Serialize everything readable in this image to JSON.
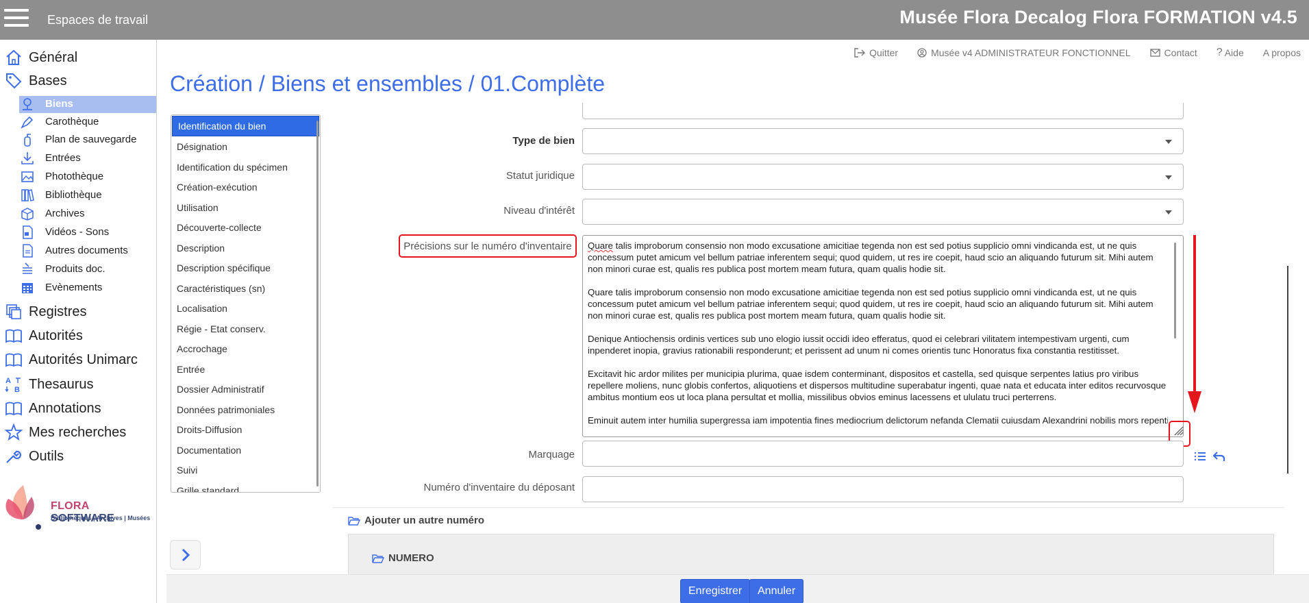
{
  "topbar": {
    "workspaces_label": "Espaces de travail",
    "app_title": "Musée Flora Decalog Flora FORMATION v4.5"
  },
  "sidebar": {
    "main_items": [
      {
        "label": "Général",
        "icon": "home-icon"
      },
      {
        "label": "Bases",
        "icon": "tag-icon"
      },
      {
        "label": "Registres",
        "icon": "registers-icon"
      },
      {
        "label": "Autorités",
        "icon": "book-icon"
      },
      {
        "label": "Autorités Unimarc",
        "icon": "book-icon"
      },
      {
        "label": "Thesaurus",
        "icon": "thesaurus-icon"
      },
      {
        "label": "Annotations",
        "icon": "book-icon"
      },
      {
        "label": "Mes recherches",
        "icon": "star-icon"
      },
      {
        "label": "Outils",
        "icon": "wrench-icon"
      }
    ],
    "sub_items": [
      {
        "label": "Biens",
        "icon": "object-icon",
        "active": true
      },
      {
        "label": "Carothèque",
        "icon": "pen-icon"
      },
      {
        "label": "Plan de sauvegarde",
        "icon": "extinguisher-icon"
      },
      {
        "label": "Entrées",
        "icon": "download-icon"
      },
      {
        "label": "Photothèque",
        "icon": "image-icon"
      },
      {
        "label": "Bibliothèque",
        "icon": "books-icon"
      },
      {
        "label": "Archives",
        "icon": "archive-box-icon"
      },
      {
        "label": "Vidéos - Sons",
        "icon": "video-icon"
      },
      {
        "label": "Autres documents",
        "icon": "document-icon"
      },
      {
        "label": "Produits doc.",
        "icon": "stack-icon"
      },
      {
        "label": "Evènements",
        "icon": "calendar-icon"
      }
    ],
    "logo": {
      "brand": "FLORA",
      "brand2": "SOFTWARE",
      "tagline": "Bibliothèques | Archives | Musées"
    }
  },
  "header_links": [
    {
      "label": "Quitter",
      "icon": "logout-icon"
    },
    {
      "label": "Musée v4 ADMINISTRATEUR FONCTIONNEL",
      "icon": "user-icon"
    },
    {
      "label": "Contact",
      "icon": "mail-icon"
    },
    {
      "label": "Aide",
      "icon": "help-icon"
    },
    {
      "label": "A propos",
      "icon": ""
    }
  ],
  "page_title": "Création / Biens et ensembles / 01.Complète",
  "sections": [
    "Identification du bien",
    "Désignation",
    "Identification du spécimen",
    "Création-exécution",
    "Utilisation",
    "Découverte-collecte",
    "Description",
    "Description spécifique",
    "Caractéristiques (sn)",
    "Localisation",
    "Régie - Etat conserv.",
    "Accrochage",
    "Entrée",
    "Dossier Administratif",
    "Données patrimoniales",
    "Droits-Diffusion",
    "Documentation",
    "Suivi",
    "Grille standard"
  ],
  "form": {
    "type_bien_label": "Type de bien",
    "type_bien_value": "",
    "statut_label": "Statut juridique",
    "statut_value": "",
    "niveau_label": "Niveau d'intérêt",
    "niveau_value": "",
    "precisions_label": "Précisions sur le numéro d'inventaire",
    "precisions_paragraphs": [
      "Quare talis improborum consensio non modo excusatione amicitiae tegenda non est sed potius supplicio omni vindicanda est, ut ne quis concessum putet amicum vel bellum patriae inferentem sequi; quod quidem, ut res ire coepit, haud scio an aliquando futurum sit. Mihi autem non minori curae est, qualis res publica post mortem meam futura, quam qualis hodie sit.",
      "Quare talis improborum consensio non modo excusatione amicitiae tegenda non est sed potius supplicio omni vindicanda est, ut ne quis concessum putet amicum vel bellum patriae inferentem sequi; quod quidem, ut res ire coepit, haud scio an aliquando futurum sit. Mihi autem non minori curae est, qualis res publica post mortem meam futura, quam qualis hodie sit.",
      "Denique Antiochensis ordinis vertices sub uno elogio iussit occidi ideo efferatus, quod ei celebrari vilitatem intempestivam urgenti, cum inpenderet inopia, gravius rationabili responderunt; et perissent ad unum ni comes orientis tunc Honoratus fixa constantia restitisset.",
      "Excitavit hic ardor milites per municipia plurima, quae isdem conterminant, dispositos et castella, sed quisque serpentes latius pro viribus repellere moliens, nunc globis confertos, aliquotiens et dispersos multitudine superabatur ingenti, quae nata et educata inter editos recurvosque ambitus montium eos ut loca plana persultat et mollia, missilibus obvios eminus lacessens et ululatu truci perterrens.",
      "Eminuit autem inter humilia supergressa iam impotentia fines mediocrium delictorum nefanda Clematii cuiusdam Alexandrini nobilis mors repentina; cuius socrus cum misceri sibi generum, flagrans eius amore, non impetraret, ut ferebatur, per palatii pseudothyrum introducta"
    ],
    "marquage_label": "Marquage",
    "marquage_value": "",
    "depositant_label": "Numéro d'inventaire du déposant",
    "depositant_value": ""
  },
  "add_section": {
    "title": "Ajouter un autre numéro",
    "subtitle": "NUMERO"
  },
  "footer": {
    "save_label": "Enregistrer",
    "cancel_label": "Annuler"
  },
  "colors": {
    "accent": "#3d6ee8",
    "topbar": "#8e8e8e",
    "highlight": "#e5151c",
    "active_section": "#2f6be4"
  }
}
